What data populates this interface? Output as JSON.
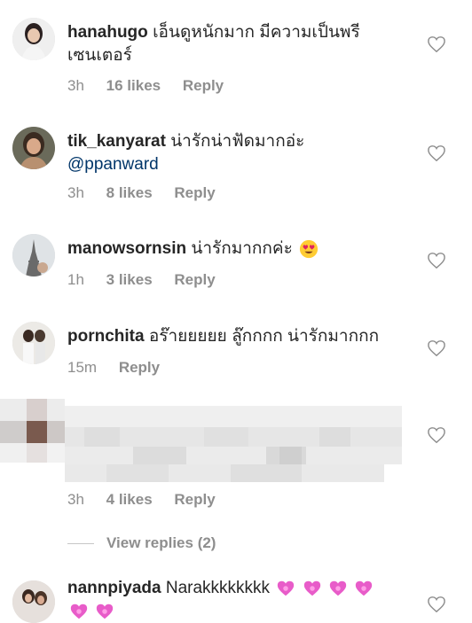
{
  "comments": [
    {
      "username": "hanahugo",
      "text": "เอ็นดูหนักมาก มีความเป็นพรีเซนเตอร์",
      "time": "3h",
      "likes": "16 likes",
      "reply": "Reply"
    },
    {
      "username": "tik_kanyarat",
      "text": "น่ารักน่าฟัดมากอ่ะ",
      "mention": "@ppanward",
      "time": "3h",
      "likes": "8 likes",
      "reply": "Reply"
    },
    {
      "username": "manowsornsin",
      "text": "น่ารักมากกค่ะ",
      "emoji": "heart-eyes-emoji",
      "time": "1h",
      "likes": "3 likes",
      "reply": "Reply"
    },
    {
      "username": "pornchita",
      "text": "อร๊ายยยยย ลู๊กกกก น่ารักมากกก",
      "time": "15m",
      "reply": "Reply"
    },
    {
      "time": "3h",
      "likes": "4 likes",
      "reply": "Reply",
      "view_replies": "View replies (2)"
    },
    {
      "username": "nannpiyada",
      "text": "Narakkkkkkkk",
      "emoji": "pink-heart-emoji"
    }
  ],
  "colors": {
    "username": "#262626",
    "meta": "#8e8e8e",
    "mention": "#003569",
    "heart_outline": "#8e8e8e"
  },
  "icons": {
    "like": "heart-outline-icon"
  }
}
